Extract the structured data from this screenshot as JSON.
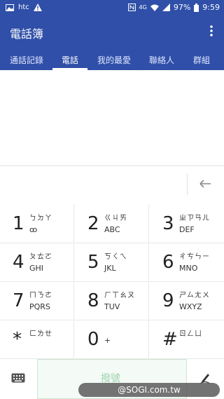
{
  "status": {
    "left_icons": [
      "image-icon",
      "htc-logo",
      "warning-icon"
    ],
    "htc_label": "htc",
    "right_icons": [
      "nfc-icon",
      "wifi-icon",
      "signal-icon",
      "battery-icon"
    ],
    "net_label": "4G",
    "battery": "97%",
    "time": "9:59"
  },
  "appbar": {
    "title": "電話簿"
  },
  "tabs": [
    {
      "label": "通話記錄",
      "active": false
    },
    {
      "label": "電話",
      "active": true
    },
    {
      "label": "我的最愛",
      "active": false
    },
    {
      "label": "聯絡人",
      "active": false
    },
    {
      "label": "群組",
      "active": false
    }
  ],
  "keypad": [
    {
      "num": "1",
      "zh": "ㄅㄉㄚ",
      "lat": "ꝏ"
    },
    {
      "num": "2",
      "zh": "ㄍㄐㄞ",
      "lat": "ABC"
    },
    {
      "num": "3",
      "zh": "ㄓㄗㄢㄦ",
      "lat": "DEF"
    },
    {
      "num": "4",
      "zh": "ㄆㄊㄛ",
      "lat": "GHI"
    },
    {
      "num": "5",
      "zh": "ㄎㄑㄟ",
      "lat": "JKL"
    },
    {
      "num": "6",
      "zh": "ㄔㄘㄣㄧ",
      "lat": "MNO"
    },
    {
      "num": "7",
      "zh": "ㄇㄋㄜ",
      "lat": "PQRS"
    },
    {
      "num": "8",
      "zh": "ㄏㄒㄠㄡ",
      "lat": "TUV"
    },
    {
      "num": "9",
      "zh": "ㄕㄙㄤㄨ",
      "lat": "WXYZ"
    },
    {
      "num": "*",
      "zh": "ㄈㄌㄝ",
      "lat": ""
    },
    {
      "num": "0",
      "zh": "",
      "lat": "+"
    },
    {
      "num": "#",
      "zh": "ㄖㄥㄩ",
      "lat": ""
    }
  ],
  "call_button": "撥號",
  "watermark": "@SOGI.com.tw",
  "colors": {
    "accent": "#2f4fa8",
    "call_text": "#9cd3ad"
  }
}
